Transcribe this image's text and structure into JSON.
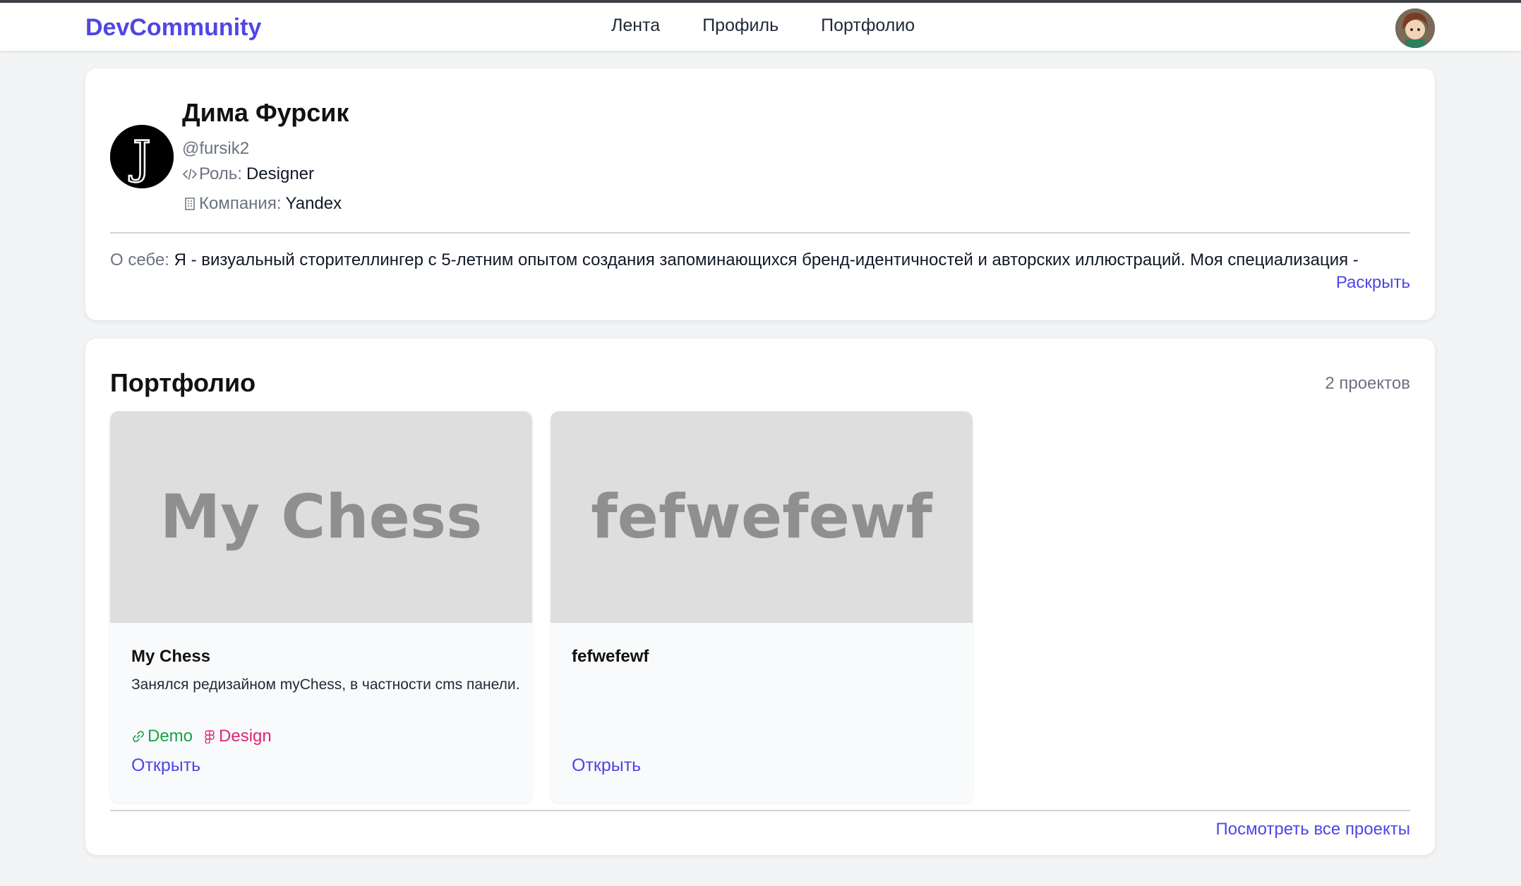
{
  "navbar": {
    "brand": "DevCommunity",
    "links": [
      {
        "label": "Лента"
      },
      {
        "label": "Профиль"
      },
      {
        "label": "Портфолио"
      }
    ]
  },
  "profile": {
    "name": "Дима Фурсик",
    "handle": "@fursik2",
    "avatar_letter": "J",
    "role_label": "Роль:",
    "role_value": "Designer",
    "company_label": "Компания:",
    "company_value": "Yandex",
    "about_label": "О себе:",
    "about_text": "Я - визуальный сторителлингер с 5-летним опытом создания запоминающихся бренд-идентичностей и авторских иллюстраций. Моя специализация -",
    "expand_label": "Раскрыть"
  },
  "portfolio": {
    "title": "Портфолио",
    "count_text": "2 проектов",
    "view_all_label": "Посмотреть все проекты",
    "projects": [
      {
        "cover_text": "My Chess",
        "name": "My Chess",
        "description": "Занялся редизайном myChess, в частности cms панели.",
        "demo_label": "Demo",
        "design_label": "Design",
        "open_label": "Открыть"
      },
      {
        "cover_text": "fefwefewf",
        "name": "fefwefewf",
        "description": "",
        "open_label": "Открыть"
      }
    ]
  },
  "colors": {
    "accent": "#4f46e5",
    "demo": "#16a34a",
    "design": "#db2777",
    "background": "#f3f4f6"
  }
}
